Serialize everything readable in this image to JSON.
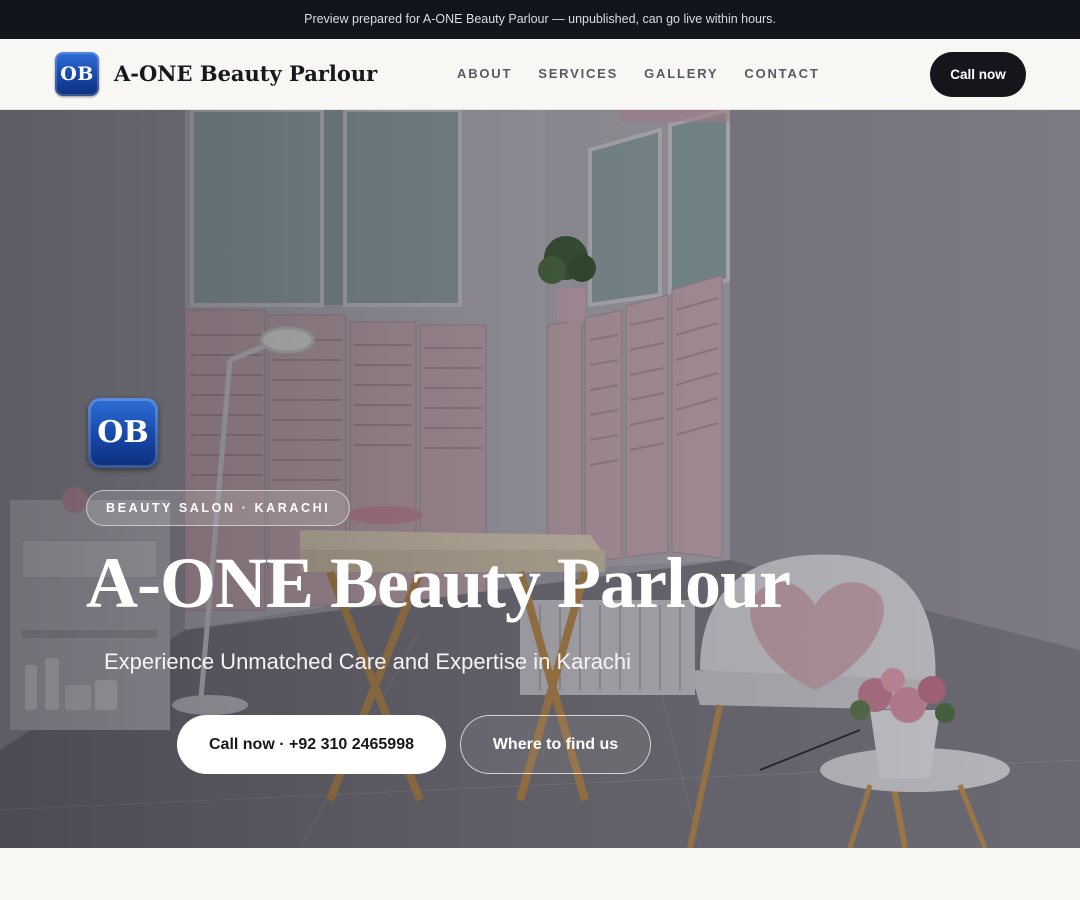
{
  "preview_bar": {
    "text": "Preview prepared for A-ONE Beauty Parlour — unpublished, can go live within hours."
  },
  "header": {
    "logo_initials": "OB",
    "brand_name": "A-ONE Beauty Parlour",
    "nav": [
      {
        "label": "ABOUT"
      },
      {
        "label": "SERVICES"
      },
      {
        "label": "GALLERY"
      },
      {
        "label": "CONTACT"
      }
    ],
    "cta_label": "Call now"
  },
  "hero": {
    "logo_initials": "OB",
    "tag": "BEAUTY SALON · KARACHI",
    "title": "A-ONE Beauty Parlour",
    "subtitle": "Experience Unmatched Care and Expertise in Karachi",
    "primary_button": "Call now · +92 310 2465998",
    "secondary_button": "Where to find us",
    "background_image": "salon-room-photo"
  },
  "colors": {
    "top_bar": "#12151b",
    "header_bg": "#f8f7f4",
    "cta_dark": "#14161c",
    "logo_blue": "#1747a8",
    "shutter_pink": "#e8c9d2"
  }
}
